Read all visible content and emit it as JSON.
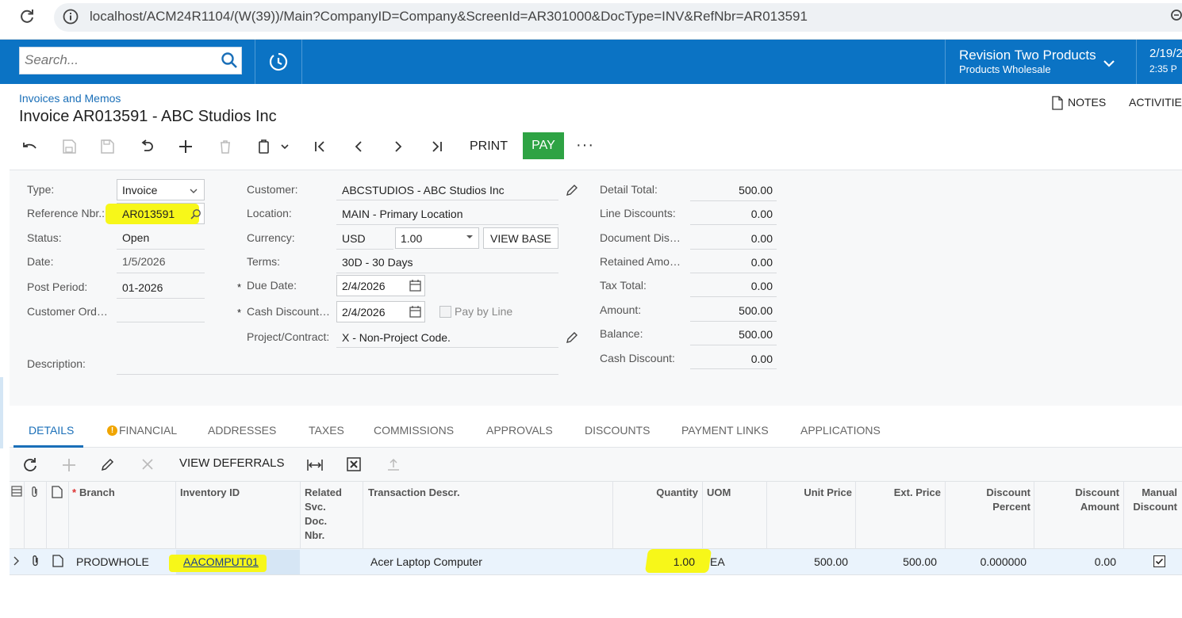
{
  "browser": {
    "url": "localhost/ACM24R1104/(W(39))/Main?CompanyID=Company&ScreenId=AR301000&DocType=INV&RefNbr=AR013591"
  },
  "header": {
    "search_placeholder": "Search...",
    "company": "Revision Two Products",
    "branch": "Products Wholesale",
    "date": "2/19/2",
    "time": "2:35 P",
    "brand_color": "#0b73c4"
  },
  "page": {
    "breadcrumb": "Invoices and Memos",
    "title": "Invoice AR013591 - ABC Studios Inc",
    "notes_label": "NOTES",
    "activities_label": "ACTIVITIES"
  },
  "toolbar": {
    "print_label": "PRINT",
    "pay_label": "PAY",
    "more_label": "···"
  },
  "form": {
    "type_label": "Type:",
    "type_value": "Invoice",
    "refnbr_label": "Reference Nbr.:",
    "refnbr_value": "AR013591",
    "status_label": "Status:",
    "status_value": "Open",
    "date_label": "Date:",
    "date_value": "1/5/2026",
    "period_label": "Post Period:",
    "period_value": "01-2026",
    "custord_label": "Customer Ord…",
    "custord_value": "",
    "description_label": "Description:",
    "description_value": "",
    "customer_label": "Customer:",
    "customer_value": "ABCSTUDIOS - ABC Studios Inc",
    "location_label": "Location:",
    "location_value": "MAIN - Primary Location",
    "currency_label": "Currency:",
    "currency_value": "USD",
    "rate_value": "1.00",
    "viewbase_label": "VIEW BASE",
    "terms_label": "Terms:",
    "terms_value": "30D - 30 Days",
    "duedate_label": "Due Date:",
    "duedate_value": "2/4/2026",
    "cashdisc_label": "Cash Discount…",
    "cashdisc_value": "2/4/2026",
    "paybyline_label": "Pay by Line",
    "project_label": "Project/Contract:",
    "project_value": "X - Non-Project Code.",
    "required_mark": "*"
  },
  "totals": {
    "detail_total_label": "Detail Total:",
    "detail_total": "500.00",
    "line_disc_label": "Line Discounts:",
    "line_disc": "0.00",
    "doc_disc_label": "Document Dis…",
    "doc_disc": "0.00",
    "retained_label": "Retained Amo…",
    "retained": "0.00",
    "tax_label": "Tax Total:",
    "tax": "0.00",
    "amount_label": "Amount:",
    "amount": "500.00",
    "balance_label": "Balance:",
    "balance": "500.00",
    "cash_disc_label": "Cash Discount:",
    "cash_disc": "0.00"
  },
  "tabs": [
    "DETAILS",
    "FINANCIAL",
    "ADDRESSES",
    "TAXES",
    "COMMISSIONS",
    "APPROVALS",
    "DISCOUNTS",
    "PAYMENT LINKS",
    "APPLICATIONS"
  ],
  "grid": {
    "view_deferrals_label": "VIEW DEFERRALS",
    "col_branch": "Branch",
    "col_inventory": "Inventory ID",
    "col_related_1": "Related",
    "col_related_2": "Svc.",
    "col_related_3": "Doc.",
    "col_related_4": "Nbr.",
    "col_descr": "Transaction Descr.",
    "col_qty": "Quantity",
    "col_uom": "UOM",
    "col_unit_price": "Unit Price",
    "col_ext_price": "Ext. Price",
    "col_disc_pct_1": "Discount",
    "col_disc_pct_2": "Percent",
    "col_disc_amt_1": "Discount",
    "col_disc_amt_2": "Amount",
    "col_manual_1": "Manual",
    "col_manual_2": "Discount",
    "row": {
      "branch": "PRODWHOLE",
      "inventory": "AACOMPUT01",
      "related": "",
      "descr": "Acer Laptop Computer",
      "qty": "1.00",
      "uom": "EA",
      "unit_price": "500.00",
      "ext_price": "500.00",
      "disc_pct": "0.000000",
      "disc_amt": "0.00",
      "manual_discount": true
    }
  }
}
